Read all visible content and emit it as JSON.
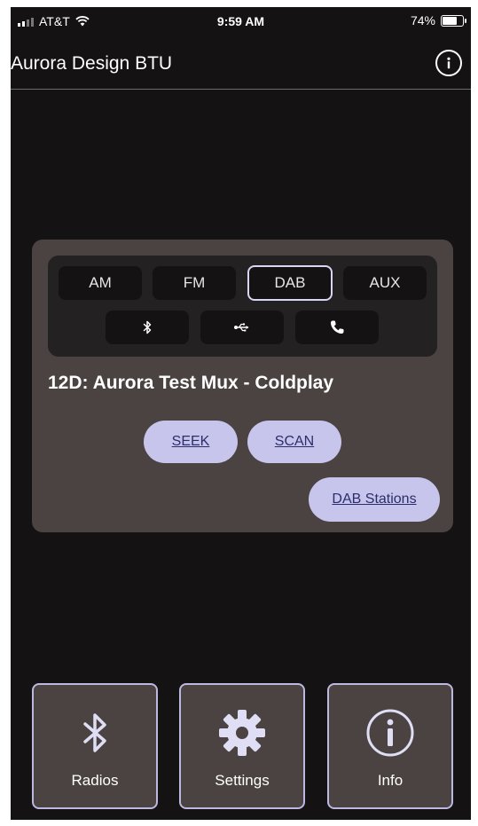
{
  "status_bar": {
    "carrier": "AT&T",
    "time": "9:59 AM",
    "battery": "74%",
    "battery_level": 0.74
  },
  "header": {
    "title": "Aurora Design BTU",
    "info_icon": "info-icon"
  },
  "modes": {
    "am": "AM",
    "fm": "FM",
    "dab": "DAB",
    "aux": "AUX",
    "selected": "DAB",
    "bluetooth_icon": "bluetooth-icon",
    "usb_icon": "usb-icon",
    "phone_icon": "phone-icon"
  },
  "station": {
    "text": "12D: Aurora Test Mux - Coldplay"
  },
  "controls": {
    "seek": "SEEK",
    "scan": "SCAN",
    "dab_stations": "DAB Stations"
  },
  "tabs": {
    "radios": "Radios",
    "settings": "Settings",
    "info": "Info"
  },
  "colors": {
    "background": "#141212",
    "card": "#4a4341",
    "pill": "#c8c5ec",
    "pill_text": "#2b2e6a",
    "accent_border": "#bcb8e0"
  }
}
